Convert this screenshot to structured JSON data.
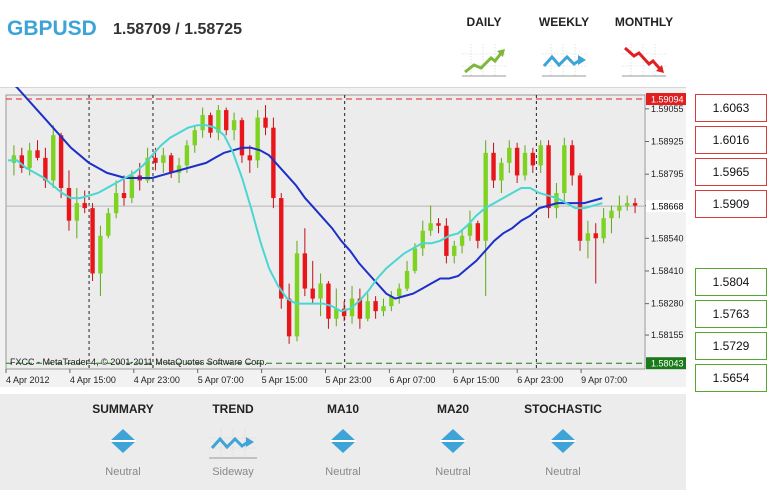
{
  "header": {
    "symbol": "GBPUSD",
    "quote": "1.58709 / 1.58725",
    "timeframes": [
      {
        "label": "DAILY",
        "icon": "trend-up-icon",
        "color": "#7eb83a"
      },
      {
        "label": "WEEKLY",
        "icon": "trend-sideway-icon",
        "color": "#3ea4d8"
      },
      {
        "label": "MONTHLY",
        "icon": "trend-down-icon",
        "color": "#e02020"
      }
    ]
  },
  "levels": {
    "resistance": [
      "1.6063",
      "1.6016",
      "1.5965",
      "1.5909"
    ],
    "support": [
      "1.5804",
      "1.5763",
      "1.5729",
      "1.5654"
    ],
    "resistance_color": "#d93a3a",
    "support_color": "#56a82f"
  },
  "indicators": [
    {
      "title": "SUMMARY",
      "value": "Neutral",
      "icon": "neutral-diamond-icon"
    },
    {
      "title": "TREND",
      "value": "Sideway",
      "icon": "sideway-trend-icon"
    },
    {
      "title": "MA10",
      "value": "Neutral",
      "icon": "neutral-diamond-icon"
    },
    {
      "title": "MA20",
      "value": "Neutral",
      "icon": "neutral-diamond-icon"
    },
    {
      "title": "STOCHASTIC",
      "value": "Neutral",
      "icon": "neutral-diamond-icon"
    }
  ],
  "chart_data": {
    "type": "candlestick",
    "watermark": "FXCC - MetaTrader 4, © 2001-2011 MetaQuotes Software Corp.",
    "ylim": [
      1.5802,
      1.5911
    ],
    "y_ticks": [
      "1.59055",
      "1.58925",
      "1.58795",
      "1.58670",
      "1.58540",
      "1.58410",
      "1.58280",
      "1.58155"
    ],
    "x_ticks": [
      "4 Apr 2012",
      "4 Apr 15:00",
      "4 Apr 23:00",
      "5 Apr 07:00",
      "5 Apr 15:00",
      "5 Apr 23:00",
      "6 Apr 07:00",
      "6 Apr 15:00",
      "6 Apr 23:00",
      "9 Apr 07:00"
    ],
    "day_separators_after_tick": [
      1,
      2,
      5,
      8
    ],
    "high_line": {
      "value": 1.59094,
      "label": "1.59094",
      "color": "#e02020"
    },
    "low_line": {
      "value": 1.58043,
      "label": "1.58043",
      "color": "#1a7a1a"
    },
    "current_price": {
      "value": 1.58668,
      "label": "1.58668"
    },
    "candles": [
      [
        1.5884,
        1.5891,
        1.5879,
        1.5887
      ],
      [
        1.5887,
        1.589,
        1.588,
        1.5882
      ],
      [
        1.5882,
        1.5892,
        1.5879,
        1.5889
      ],
      [
        1.5889,
        1.5893,
        1.5885,
        1.5886
      ],
      [
        1.5886,
        1.589,
        1.5874,
        1.5877
      ],
      [
        1.5877,
        1.5899,
        1.5874,
        1.5895
      ],
      [
        1.5895,
        1.5896,
        1.587,
        1.5874
      ],
      [
        1.5874,
        1.5881,
        1.5857,
        1.5861
      ],
      [
        1.5861,
        1.5874,
        1.5854,
        1.5868
      ],
      [
        1.5868,
        1.5873,
        1.5864,
        1.5866
      ],
      [
        1.5866,
        1.5868,
        1.5837,
        1.584
      ],
      [
        1.584,
        1.5859,
        1.5831,
        1.5855
      ],
      [
        1.5855,
        1.5866,
        1.5854,
        1.5864
      ],
      [
        1.5864,
        1.5877,
        1.5862,
        1.5872
      ],
      [
        1.5872,
        1.5879,
        1.5867,
        1.587
      ],
      [
        1.587,
        1.5881,
        1.5868,
        1.5879
      ],
      [
        1.5879,
        1.5884,
        1.5873,
        1.5877
      ],
      [
        1.5877,
        1.589,
        1.5876,
        1.5886
      ],
      [
        1.5886,
        1.589,
        1.5881,
        1.5884
      ],
      [
        1.5884,
        1.589,
        1.588,
        1.5887
      ],
      [
        1.5887,
        1.5888,
        1.5878,
        1.588
      ],
      [
        1.588,
        1.5886,
        1.5876,
        1.5883
      ],
      [
        1.5883,
        1.5893,
        1.588,
        1.5891
      ],
      [
        1.5891,
        1.5899,
        1.5888,
        1.5897
      ],
      [
        1.5897,
        1.5906,
        1.5894,
        1.5903
      ],
      [
        1.5903,
        1.5904,
        1.5894,
        1.5896
      ],
      [
        1.5896,
        1.5907,
        1.5893,
        1.5905
      ],
      [
        1.5905,
        1.5906,
        1.5895,
        1.5897
      ],
      [
        1.5897,
        1.5904,
        1.5893,
        1.5901
      ],
      [
        1.5901,
        1.5902,
        1.5884,
        1.5887
      ],
      [
        1.5887,
        1.5891,
        1.588,
        1.5885
      ],
      [
        1.5885,
        1.5905,
        1.5882,
        1.5902
      ],
      [
        1.5902,
        1.5907,
        1.5895,
        1.5898
      ],
      [
        1.5898,
        1.5902,
        1.5866,
        1.587
      ],
      [
        1.587,
        1.5872,
        1.5826,
        1.583
      ],
      [
        1.583,
        1.5836,
        1.5812,
        1.5815
      ],
      [
        1.5815,
        1.5853,
        1.5813,
        1.5848
      ],
      [
        1.5848,
        1.5858,
        1.5831,
        1.5834
      ],
      [
        1.5834,
        1.5845,
        1.5828,
        1.583
      ],
      [
        1.583,
        1.584,
        1.5823,
        1.5836
      ],
      [
        1.5836,
        1.5837,
        1.5818,
        1.5822
      ],
      [
        1.5822,
        1.5834,
        1.5819,
        1.5826
      ],
      [
        1.5826,
        1.5829,
        1.5821,
        1.5823
      ],
      [
        1.5823,
        1.5835,
        1.582,
        1.583
      ],
      [
        1.583,
        1.5834,
        1.5818,
        1.5822
      ],
      [
        1.5822,
        1.5832,
        1.5821,
        1.5829
      ],
      [
        1.5829,
        1.5831,
        1.5822,
        1.5825
      ],
      [
        1.5825,
        1.583,
        1.5823,
        1.5827
      ],
      [
        1.5827,
        1.5833,
        1.5825,
        1.5831
      ],
      [
        1.5831,
        1.5836,
        1.5828,
        1.5834
      ],
      [
        1.5834,
        1.5845,
        1.5833,
        1.5841
      ],
      [
        1.5841,
        1.5852,
        1.584,
        1.585
      ],
      [
        1.585,
        1.5861,
        1.5847,
        1.5857
      ],
      [
        1.5857,
        1.5867,
        1.5855,
        1.586
      ],
      [
        1.586,
        1.5862,
        1.5856,
        1.5859
      ],
      [
        1.5859,
        1.5862,
        1.5844,
        1.5847
      ],
      [
        1.5847,
        1.5853,
        1.5844,
        1.5851
      ],
      [
        1.5851,
        1.5857,
        1.5848,
        1.5855
      ],
      [
        1.5855,
        1.5865,
        1.5853,
        1.586
      ],
      [
        1.586,
        1.5861,
        1.585,
        1.5853
      ],
      [
        1.5853,
        1.5893,
        1.5831,
        1.5888
      ],
      [
        1.5888,
        1.5892,
        1.5874,
        1.5877
      ],
      [
        1.5877,
        1.5886,
        1.5872,
        1.5884
      ],
      [
        1.5884,
        1.5893,
        1.588,
        1.589
      ],
      [
        1.589,
        1.5892,
        1.5876,
        1.5879
      ],
      [
        1.5879,
        1.5891,
        1.5877,
        1.5888
      ],
      [
        1.5888,
        1.589,
        1.588,
        1.5883
      ],
      [
        1.5883,
        1.5893,
        1.588,
        1.5891
      ],
      [
        1.5891,
        1.5893,
        1.5862,
        1.5866
      ],
      [
        1.5866,
        1.5876,
        1.5862,
        1.5872
      ],
      [
        1.5872,
        1.5894,
        1.5868,
        1.5891
      ],
      [
        1.5891,
        1.5893,
        1.5875,
        1.5879
      ],
      [
        1.5879,
        1.588,
        1.5849,
        1.5853
      ],
      [
        1.5853,
        1.5861,
        1.5846,
        1.5856
      ],
      [
        1.5856,
        1.586,
        1.5836,
        1.5854
      ],
      [
        1.5854,
        1.5866,
        1.5852,
        1.5862
      ],
      [
        1.5862,
        1.5867,
        1.5856,
        1.5865
      ],
      [
        1.5865,
        1.5871,
        1.5862,
        1.5867
      ],
      [
        1.5867,
        1.5871,
        1.5865,
        1.5868
      ],
      [
        1.5868,
        1.587,
        1.5864,
        1.5867
      ]
    ],
    "series": [
      {
        "name": "",
        "color": "#1c2fc8",
        "values": [
          1.5917,
          1.5914,
          1.591,
          1.5906,
          1.5902,
          1.5898,
          1.5894,
          1.589,
          1.5887,
          1.5884,
          1.5882,
          1.588,
          1.5879,
          1.5878,
          1.5878,
          1.5878,
          1.5878,
          1.5879,
          1.588,
          1.5881,
          1.5882,
          1.5883,
          1.5884,
          1.5886,
          1.5888,
          1.5889,
          1.589,
          1.589,
          1.5889,
          1.5887,
          1.5883,
          1.5879,
          1.5875,
          1.587,
          1.5866,
          1.5862,
          1.5858,
          1.5853,
          1.5849,
          1.5844,
          1.584,
          1.5836,
          1.5832,
          1.583,
          1.5831,
          1.5832,
          1.5834,
          1.5836,
          1.5838,
          1.5838,
          1.5839,
          1.5842,
          1.5845,
          1.5849,
          1.5853,
          1.5856,
          1.5858,
          1.5861,
          1.5863,
          1.5866,
          1.5867,
          1.5868,
          1.5868,
          1.5868,
          1.5868,
          1.5869,
          1.587
        ]
      },
      {
        "name": "",
        "color": "#4ad6d2",
        "values": [
          1.5885,
          1.5885,
          1.5882,
          1.588,
          1.5878,
          1.5875,
          1.5872,
          1.587,
          1.587,
          1.5871,
          1.5872,
          1.5874,
          1.5876,
          1.5878,
          1.588,
          1.5883,
          1.5887,
          1.5891,
          1.5894,
          1.5896,
          1.5898,
          1.5899,
          1.5899,
          1.5898,
          1.5895,
          1.5888,
          1.5878,
          1.5866,
          1.5853,
          1.5842,
          1.5835,
          1.583,
          1.5828,
          1.5828,
          1.5828,
          1.5828,
          1.5827,
          1.5825,
          1.5826,
          1.5829,
          1.5833,
          1.5838,
          1.5842,
          1.5845,
          1.5848,
          1.585,
          1.5852,
          1.5852,
          1.5853,
          1.5855,
          1.5856,
          1.5859,
          1.5863,
          1.5866,
          1.5868,
          1.587,
          1.5872,
          1.5874,
          1.5874,
          1.5872,
          1.5871,
          1.587,
          1.5868,
          1.5866,
          1.5866,
          1.5867,
          1.5868
        ]
      }
    ]
  }
}
